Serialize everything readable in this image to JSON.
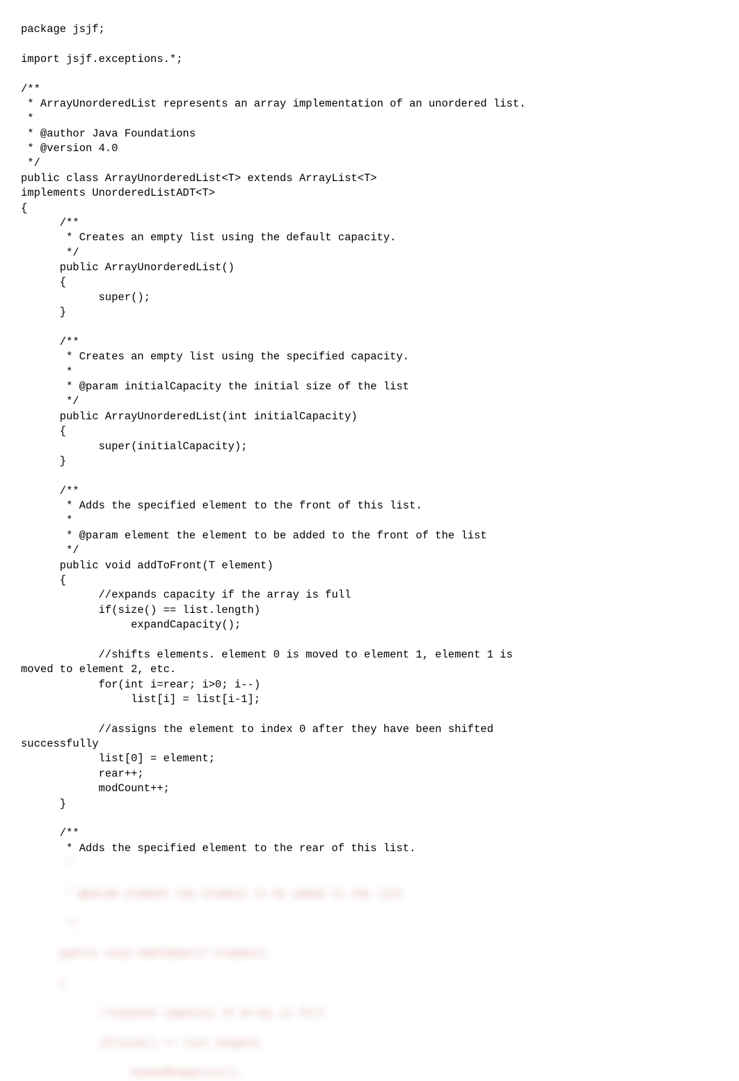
{
  "code_lines": [
    "package jsjf;",
    "",
    "import jsjf.exceptions.*;",
    "",
    "/**",
    " * ArrayUnorderedList represents an array implementation of an unordered list.",
    " *",
    " * @author Java Foundations",
    " * @version 4.0",
    " */",
    "public class ArrayUnorderedList<T> extends ArrayList<T>",
    "implements UnorderedListADT<T>",
    "{",
    "      /**",
    "       * Creates an empty list using the default capacity.",
    "       */",
    "      public ArrayUnorderedList()",
    "      {",
    "            super();",
    "      }",
    "",
    "      /**",
    "       * Creates an empty list using the specified capacity.",
    "       *",
    "       * @param initialCapacity the initial size of the list",
    "       */",
    "      public ArrayUnorderedList(int initialCapacity)",
    "      {",
    "            super(initialCapacity);",
    "      }",
    "",
    "      /**",
    "       * Adds the specified element to the front of this list.",
    "       *",
    "       * @param element the element to be added to the front of the list",
    "       */",
    "      public void addToFront(T element)",
    "      {",
    "            //expands capacity if the array is full",
    "            if(size() == list.length)",
    "                 expandCapacity();",
    "",
    "            //shifts elements. element 0 is moved to element 1, element 1 is",
    "moved to element 2, etc.",
    "            for(int i=rear; i>0; i--)",
    "                 list[i] = list[i-1];",
    "",
    "            //assigns the element to index 0 after they have been shifted",
    "successfully",
    "            list[0] = element;",
    "            rear++;",
    "            modCount++;",
    "      }",
    "",
    "      /**",
    "       * Adds the specified element to the rear of this list."
  ],
  "blurred_lines": [
    "       *",
    "       * @param element the element to be added to the list",
    "       */",
    "      public void addToRear(T element)",
    "      {",
    "            //expands capacity if array is full",
    "            if(size() == list.length)",
    "                 expandCapacity();"
  ]
}
